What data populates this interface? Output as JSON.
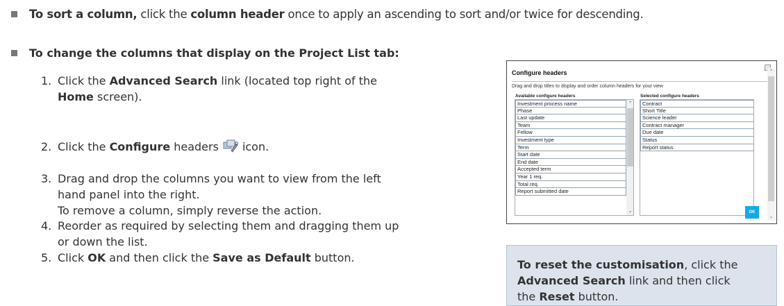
{
  "intro": {
    "sort_bold": "To sort a column,",
    "sort_mid1": " click the ",
    "sort_bold2": "column header",
    "sort_rest": " once to apply an ascending to sort and/or twice for descending."
  },
  "change_heading": "To change the columns that display on the Project List tab:",
  "steps": [
    {
      "num": "1.",
      "p1": "Click the ",
      "b1": "Advanced Search",
      "p2": " link (located top right of the",
      "b2": "Home",
      "p3": " screen)."
    },
    {
      "num": "2.",
      "p1": "Click the ",
      "b1": "Configure",
      "p2": " headers",
      "p3": "icon.",
      "icon": "configure-headers-icon"
    },
    {
      "num": "3.",
      "l1": "Drag and drop the columns you want to view from the left",
      "l2": "hand panel into the right.",
      "l3": "To remove a column, simply reverse the action."
    },
    {
      "num": "4.",
      "l1": "Reorder as required by selecting them and dragging them up",
      "l2": "or down the list."
    },
    {
      "num": "5.",
      "p1": "Click ",
      "b1": "OK",
      "p2": " and then click the ",
      "b2": "Save as Default",
      "p3": " button."
    }
  ],
  "dialog": {
    "title": "Configure headers",
    "instruction": "Drag and drop titles to display and order column headers for your view",
    "available_heading": "Available configure headers",
    "selected_heading": "Selected configure headers",
    "available": [
      "Investment process name",
      "Phase",
      "Last update",
      "Team",
      "Fellow",
      "Investment type",
      "Term",
      "Start date",
      "End date",
      "Accepted term",
      "Year 1 req.",
      "Total req.",
      "Report submitted date"
    ],
    "selected": [
      "Contract",
      "Short Title",
      "Science leader",
      "Contract manager",
      "Due date",
      "Status",
      "Report status"
    ],
    "ok_label": "OK",
    "accent_color": "#12a9e8"
  },
  "note": {
    "b1": "To reset the customisation",
    "p1": ", click the",
    "b2": "Advanced Search",
    "p2": " link and then click",
    "p3": "the ",
    "b3": "Reset",
    "p4": " button."
  }
}
